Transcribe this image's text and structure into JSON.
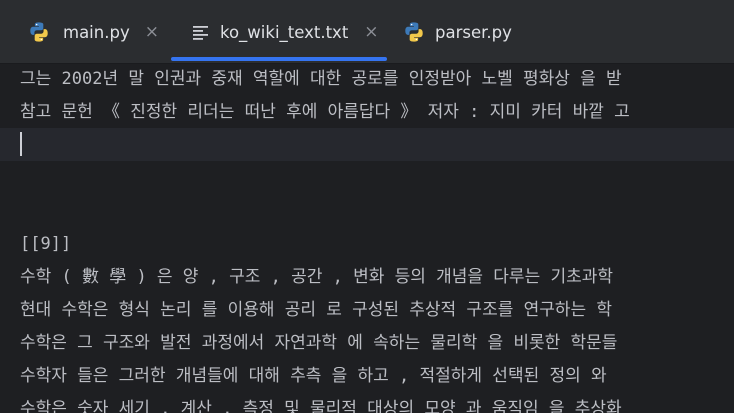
{
  "tabs": [
    {
      "label": "main.py",
      "icon": "python-icon",
      "active": false
    },
    {
      "label": "ko_wiki_text.txt",
      "icon": "text-file-icon",
      "active": true
    },
    {
      "label": "parser.py",
      "icon": "python-icon",
      "active": false
    }
  ],
  "close_glyph": "×",
  "editor": {
    "lines": [
      "그는 2002년 말 인권과 중재 역할에 대한 공로를 인정받아 노벨 평화상 을 받",
      "참고 문헌 《 진정한 리더는 떠난 후에 아름답다 》 저자 : 지미 카터 바깥 고",
      "",
      "",
      "",
      "[[9]]",
      "수학 ( 數 學 ) 은 양 , 구조 , 공간 , 변화 등의 개념을 다루는 기초과학",
      "현대 수학은 형식 논리 를 이용해 공리 로 구성된 추상적 구조를 연구하는 학",
      "수학은 그 구조와 발전 과정에서 자연과학 에 속하는 물리학 을 비롯한 학문들",
      "수학자 들은 그러한 개념들에 대해 추측 을 하고 , 적절하게 선택된 정의 와 ",
      "수학은 숫자 세기 , 계산 , 측정 및 물리적 대상의 모양 과 움직임 을 추상화"
    ]
  },
  "colors": {
    "background": "#1e1f22",
    "tabbar": "#2b2d30",
    "text": "#bcbec4",
    "active_tab_underline": "#3574f0",
    "python_blue": "#3d7ab8",
    "python_yellow": "#f2c84b"
  }
}
